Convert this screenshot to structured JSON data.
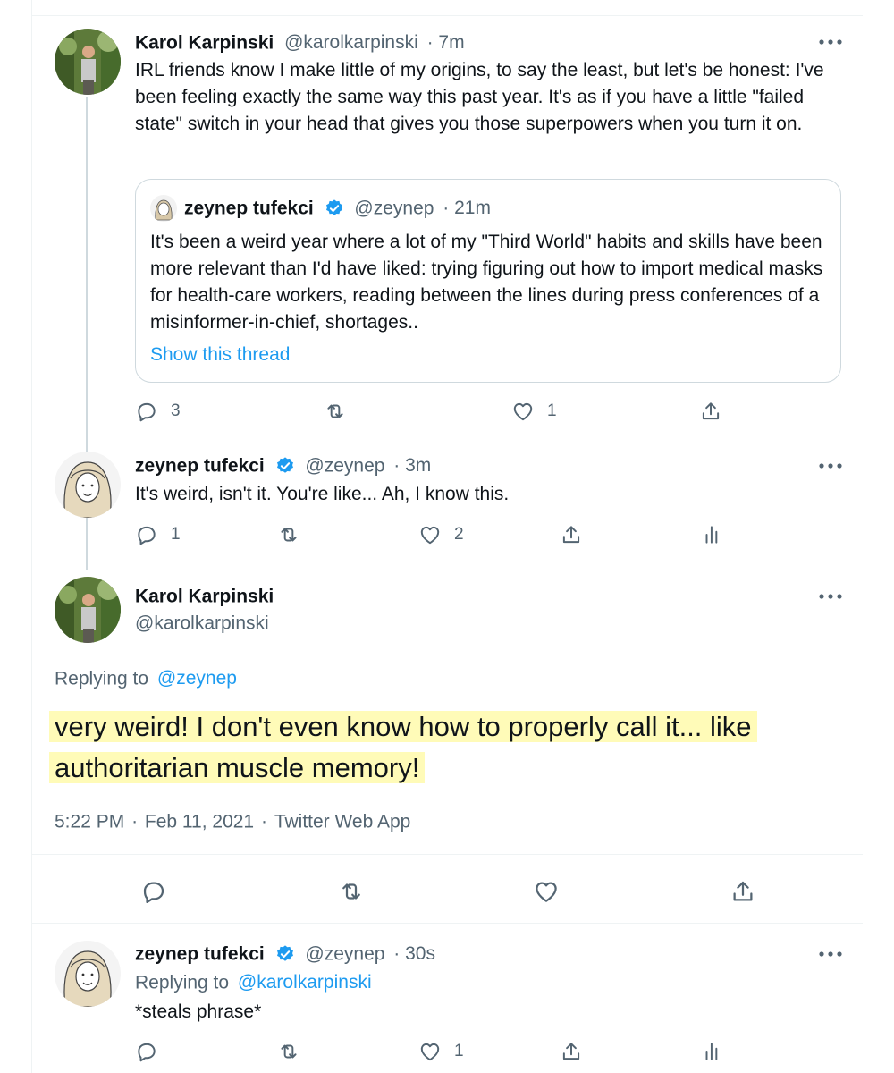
{
  "tweets": [
    {
      "name": "Karol Karpinski",
      "handle": "@karolkarpinski",
      "time": "· 7m",
      "text": "IRL friends know I make little of my origins, to say the least, but let's be honest: I've been feeling exactly the same way this past year. It's as if you have a little \"failed state\" switch in your head that gives you those superpowers when you turn it on.",
      "reply_count": "3",
      "retweet_count": "",
      "like_count": "1"
    },
    {
      "name": "zeynep tufekci",
      "handle": "@zeynep",
      "time": "· 3m",
      "text": "It's weird, isn't it. You're like... Ah, I know this.",
      "reply_count": "1",
      "retweet_count": "",
      "like_count": "2"
    },
    {
      "name": "zeynep tufekci",
      "handle": "@zeynep",
      "time": "· 30s",
      "replying_prefix": "Replying to",
      "replying_to": "@karolkarpinski",
      "text": "*steals phrase*",
      "reply_count": "",
      "retweet_count": "",
      "like_count": "1"
    }
  ],
  "quote": {
    "name": "zeynep tufekci",
    "handle": "@zeynep",
    "time": "· 21m",
    "text": "It's been a weird year where a lot of my \"Third World\" habits and skills have been more relevant than I'd have liked: trying figuring out how to import medical masks for health-care workers, reading between the lines during press conferences of a misinformer-in-chief, shortages..",
    "show_thread": "Show this thread"
  },
  "focus": {
    "name": "Karol Karpinski",
    "handle": "@karolkarpinski",
    "replying_prefix": "Replying to",
    "replying_to": "@zeynep",
    "text": "very weird! I don't even know how to properly call it... like authoritarian muscle memory!",
    "time": "5:22 PM",
    "date": "Feb 11, 2021",
    "source": "Twitter Web App",
    "dot1": "·",
    "dot2": "·"
  },
  "colors": {
    "accent": "#1d9bf0",
    "secondary_text": "#536471",
    "highlight": "#fffbb8",
    "border": "#eff3f4"
  },
  "icons": {
    "reply": "reply-icon",
    "retweet": "retweet-icon",
    "like": "heart-icon",
    "share": "share-icon",
    "analytics": "analytics-icon",
    "more": "more-icon",
    "verified": "verified-badge-icon"
  }
}
